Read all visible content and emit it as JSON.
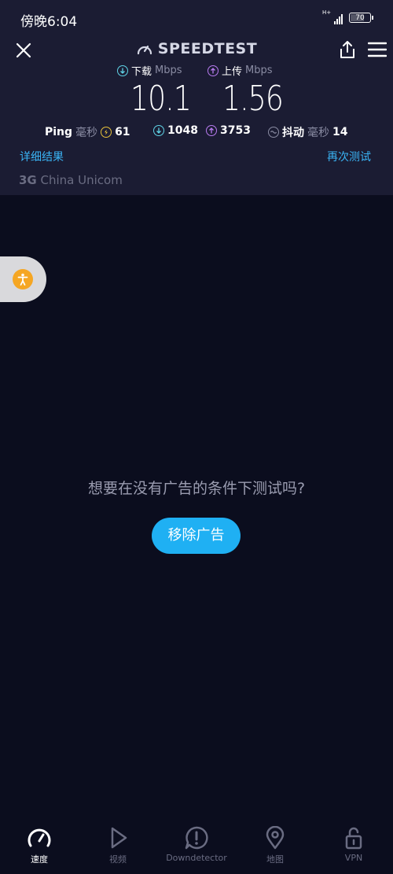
{
  "status_bar": {
    "time": "傍晚6:04",
    "network_type": "H+",
    "battery": "70"
  },
  "header": {
    "logo_text": "SPEEDTEST",
    "download": {
      "label": "下载",
      "unit": "Mbps",
      "value": "10.1"
    },
    "upload": {
      "label": "上传",
      "unit": "Mbps",
      "value": "1.56"
    },
    "ping": {
      "label": "Ping",
      "unit": "毫秒",
      "value": "61",
      "download_latency": "1048",
      "upload_latency": "3753"
    },
    "jitter": {
      "label": "抖动",
      "unit": "毫秒",
      "value": "14"
    },
    "details_link": "详细结果",
    "retest_link": "再次测试",
    "carrier": {
      "network": "3G",
      "name": "China Unicom"
    }
  },
  "ad": {
    "prompt": "想要在没有广告的条件下测试吗?",
    "remove_button": "移除广告"
  },
  "bottom_nav": {
    "items": [
      {
        "label": "速度",
        "icon": "speedometer-icon",
        "active": true
      },
      {
        "label": "视频",
        "icon": "play-icon",
        "active": false
      },
      {
        "label": "Downdetector",
        "icon": "alert-icon",
        "active": false
      },
      {
        "label": "地图",
        "icon": "map-pin-icon",
        "active": false
      },
      {
        "label": "VPN",
        "icon": "lock-icon",
        "active": false
      }
    ]
  },
  "colors": {
    "background": "#0b0d1e",
    "header": "#1b1c33",
    "accent": "#1fb0f3",
    "download": "#5fd3e6",
    "upload": "#b87bf0",
    "ping": "#e8c13a"
  }
}
